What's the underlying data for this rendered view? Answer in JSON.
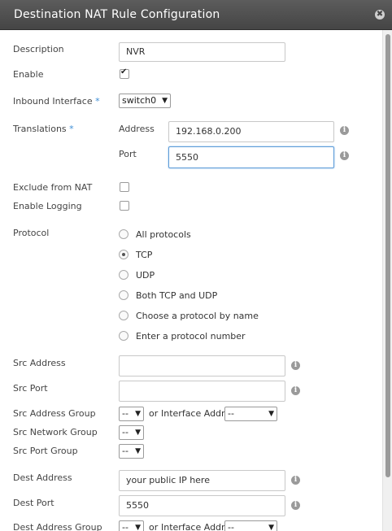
{
  "dialog": {
    "title": "Destination NAT Rule Configuration",
    "close_glyph": "✖"
  },
  "labels": {
    "description": "Description",
    "enable": "Enable",
    "inbound_interface": "Inbound Interface",
    "translations": "Translations",
    "address": "Address",
    "port": "Port",
    "exclude": "Exclude from NAT",
    "logging": "Enable Logging",
    "protocol": "Protocol",
    "src_address": "Src Address",
    "src_port": "Src Port",
    "src_address_group": "Src Address Group",
    "src_network_group": "Src Network Group",
    "src_port_group": "Src Port Group",
    "dest_address": "Dest Address",
    "dest_port": "Dest Port",
    "dest_address_group": "Dest Address Group",
    "required_mark": "*",
    "or": "or",
    "interface_addr": "Interface Addr"
  },
  "values": {
    "description": "NVR",
    "enable_checked": true,
    "inbound_interface": "switch0",
    "translation_address": "192.168.0.200",
    "translation_port": "5550",
    "exclude_checked": false,
    "logging_checked": false,
    "src_address": "",
    "src_port": "",
    "src_address_group": "--",
    "src_interface_addr": "--",
    "src_network_group": "--",
    "src_port_group": "--",
    "dest_address": "your public IP here",
    "dest_port": "5550",
    "dest_address_group": "--",
    "dest_interface_addr": "--"
  },
  "protocol_options": [
    {
      "label": "All protocols",
      "selected": false
    },
    {
      "label": "TCP",
      "selected": true
    },
    {
      "label": "UDP",
      "selected": false
    },
    {
      "label": "Both TCP and UDP",
      "selected": false
    },
    {
      "label": "Choose a protocol by name",
      "selected": false
    },
    {
      "label": "Enter a protocol number",
      "selected": false
    }
  ],
  "icons": {
    "info": "info-icon",
    "dropdown": "chevron-down-icon",
    "close": "close-icon",
    "checkmark": "check-icon"
  },
  "glyphs": {
    "info": "i",
    "arrow": "▼"
  }
}
